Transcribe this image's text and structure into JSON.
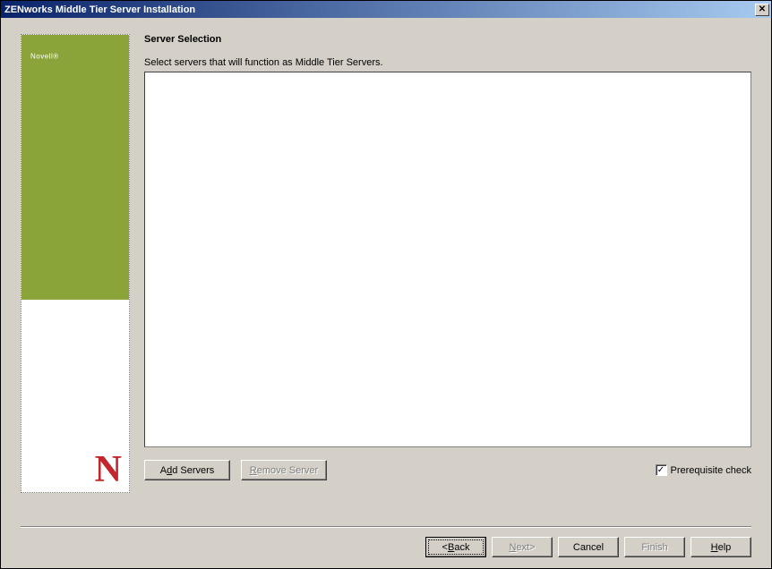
{
  "window": {
    "title": "ZENworks Middle Tier Server Installation"
  },
  "sidebar": {
    "brand": "Novell",
    "brand_suffix": "®",
    "logo_letter": "N"
  },
  "main": {
    "heading": "Server Selection",
    "instruction": "Select servers that will function as Middle Tier Servers."
  },
  "buttons": {
    "add_servers_pre": "A",
    "add_servers_ul": "d",
    "add_servers_post": "d Servers",
    "remove_server_ul": "R",
    "remove_server_post": "emove Server",
    "prereq_label": "Prerequisite check",
    "prereq_checked": "✓",
    "back": "<",
    "back_ul": "B",
    "back_post": "ack",
    "next_ul": "N",
    "next_post": "ext>",
    "cancel": "Cancel",
    "finish": "Finish",
    "help_ul": "H",
    "help_post": "elp"
  }
}
